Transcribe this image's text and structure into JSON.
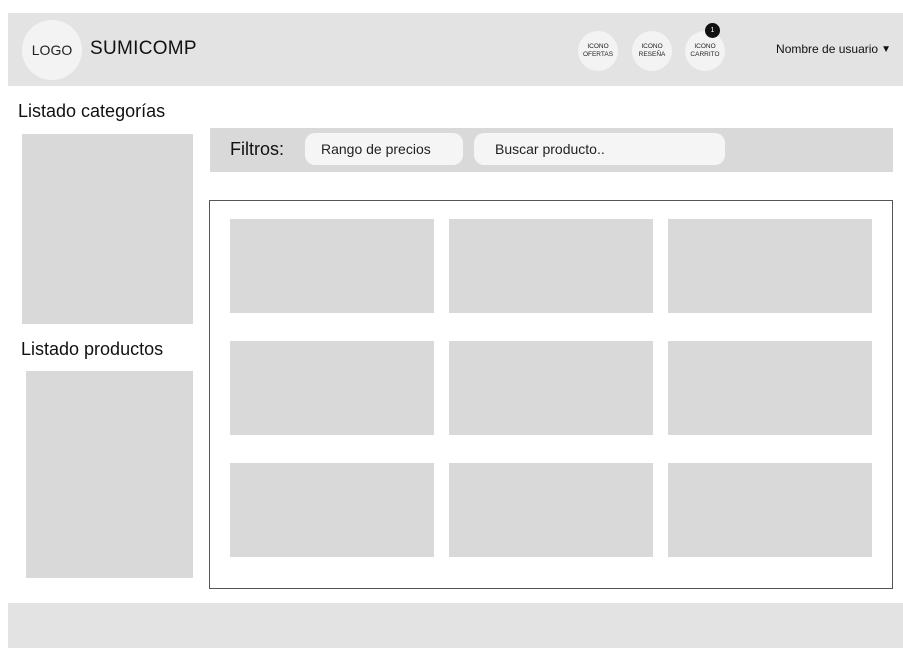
{
  "header": {
    "logo_text": "LOGO",
    "brand_name": "SUMICOMP",
    "icons": [
      {
        "line1": "ICONO",
        "line2": "OFERTAS"
      },
      {
        "line1": "ICONO",
        "line2": "RESEÑA"
      },
      {
        "line1": "ICONO",
        "line2": "CARRITO",
        "badge": "1"
      }
    ],
    "user_name": "Nombre de usuario",
    "user_caret": "▼"
  },
  "sidebar": {
    "categories_title": "Listado categorías",
    "products_title": "Listado productos"
  },
  "filters": {
    "label": "Filtros:",
    "price_range": "Rango de precios",
    "search_placeholder": "Buscar producto.."
  },
  "colors": {
    "header_bg": "#e3e3e3",
    "placeholder_gray": "#d9d9d9",
    "badge_bg": "#111111"
  }
}
